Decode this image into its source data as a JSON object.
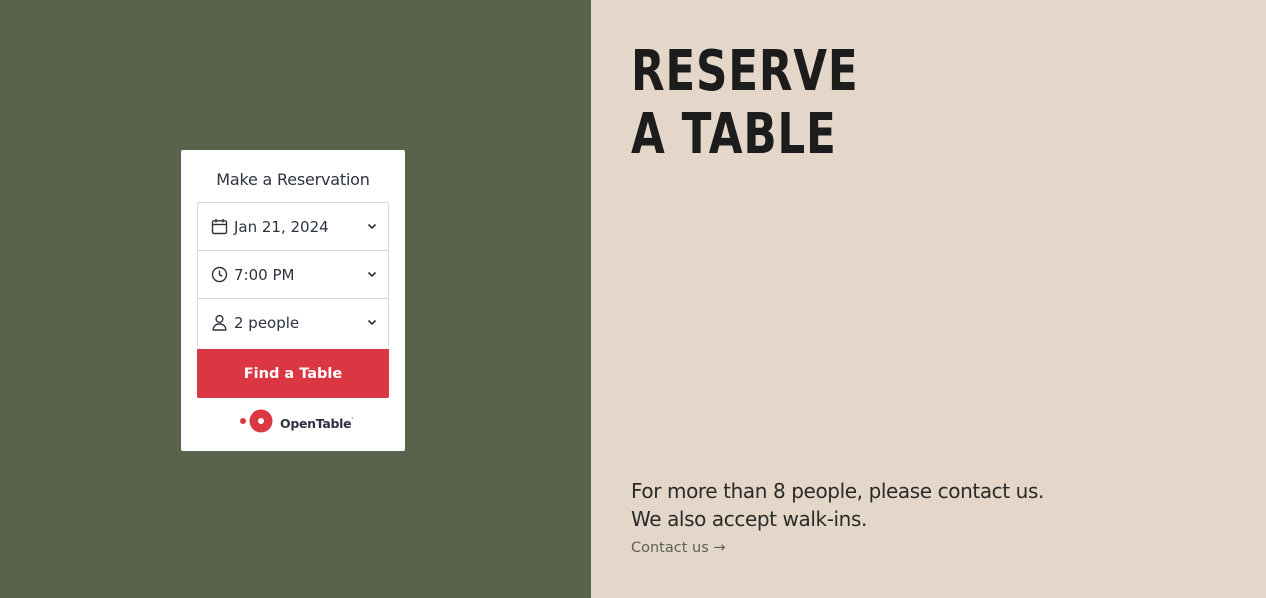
{
  "reservation_widget": {
    "title": "Make a Reservation",
    "date": "Jan 21, 2024",
    "time": "7:00 PM",
    "party_size": "2 people",
    "button_label": "Find a Table",
    "provider_name": "OpenTable",
    "provider_tm": "·"
  },
  "hero": {
    "headline_line1": "RESERVE",
    "headline_line2": "A TABLE"
  },
  "info": {
    "line1": "For more than 8 people, please contact us.",
    "line2": "We also accept walk-ins.",
    "contact_link": "Contact us →"
  },
  "icons": {
    "date": "calendar-icon",
    "time": "clock-icon",
    "party": "person-icon",
    "dropdown": "chevron-down-icon",
    "logo": "opentable-logo-icon"
  },
  "colors": {
    "left_background": "#59634c",
    "right_background": "#e4d7ca",
    "button": "#da3743",
    "headline": "#1b1c1b",
    "link": "#59634c"
  }
}
